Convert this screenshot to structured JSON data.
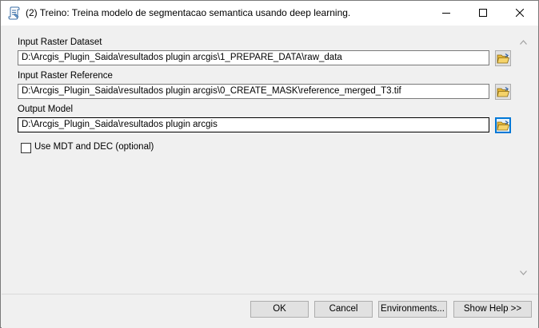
{
  "window": {
    "title": "(2) Treino: Treina modelo de segmentacao semantica usando deep learning.",
    "icon": "script-tool-icon"
  },
  "fields": [
    {
      "label": "Input Raster Dataset",
      "value": "D:\\Arcgis_Plugin_Saida\\resultados plugin arcgis\\1_PREPARE_DATA\\raw_data"
    },
    {
      "label": "Input Raster Reference",
      "value": "D:\\Arcgis_Plugin_Saida\\resultados plugin arcgis\\0_CREATE_MASK\\reference_merged_T3.tif"
    },
    {
      "label": "Output Model",
      "value": "D:\\Arcgis_Plugin_Saida\\resultados plugin arcgis"
    }
  ],
  "checkbox": {
    "label": "Use MDT and DEC (optional)",
    "checked": false
  },
  "buttons": {
    "ok": "OK",
    "cancel": "Cancel",
    "environments": "Environments...",
    "show_help": "Show Help >>"
  },
  "colors": {
    "dialog_background": "#f0f0f0",
    "focus_accent": "#0078d7",
    "folder_icon": "#f5c542"
  }
}
